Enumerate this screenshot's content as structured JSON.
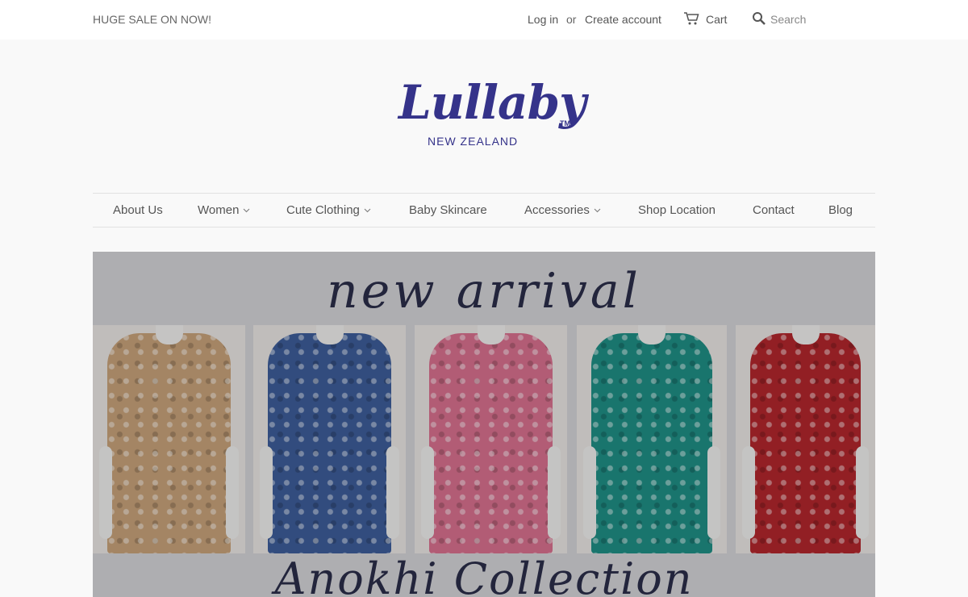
{
  "topbar": {
    "promo": "HUGE SALE ON NOW!",
    "login": "Log in",
    "or": "or",
    "create_account": "Create account",
    "cart": "Cart",
    "search_placeholder": "Search"
  },
  "logo": {
    "script": "Lullaby",
    "tm": "TM",
    "sub": "NEW ZEALAND",
    "color": "#35338a"
  },
  "nav": {
    "items": [
      {
        "label": "About Us",
        "dropdown": false
      },
      {
        "label": "Women",
        "dropdown": true
      },
      {
        "label": "Cute Clothing",
        "dropdown": true
      },
      {
        "label": "Baby Skincare",
        "dropdown": false
      },
      {
        "label": "Accessories",
        "dropdown": true
      },
      {
        "label": "Shop Location",
        "dropdown": false
      },
      {
        "label": "Contact",
        "dropdown": false
      },
      {
        "label": "Blog",
        "dropdown": false
      }
    ]
  },
  "banner": {
    "headline": "new arrival",
    "subhead": "Anokhi Collection",
    "garment_colors": [
      "#c9a37a",
      "#3d5d9a",
      "#d9718f",
      "#1f8f86",
      "#b3262c"
    ]
  }
}
